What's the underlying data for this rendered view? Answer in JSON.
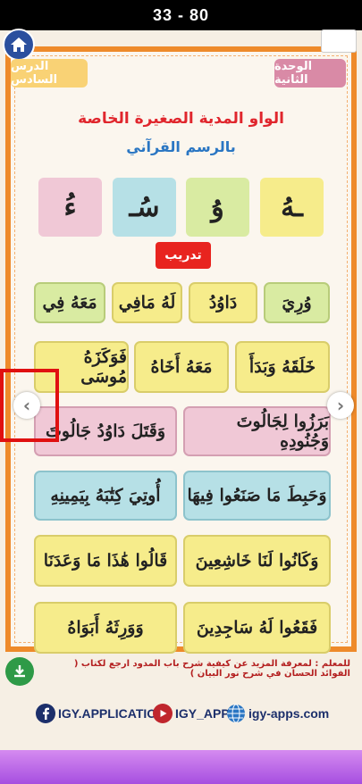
{
  "header": {
    "page_indicator": "33 - 80"
  },
  "badges": {
    "unit": "الوحدة الثانية",
    "lesson": "الدرس السادس"
  },
  "titles": {
    "main": "الواو المدية الصغيرة الخاصة",
    "sub": "بالرسم القرآني"
  },
  "letters": [
    "ـهُ",
    "ۇ",
    "سُـ",
    "ءُ"
  ],
  "drill_label": "تدريب",
  "rows": [
    [
      "وُرِيَ",
      "دَاوُدُ",
      "لَهُ مَافِي",
      "مَعَهُ فِي"
    ],
    [
      "خَلَقَهُ وَبَدَأَ",
      "مَعَهُ أَخَاهُ",
      "فَوَكَزَهُ مُوسَى"
    ],
    [
      "بَرَزُوا لِجَالُوتَ وَجُنُودِهِ",
      "وَقَتَلَ دَاوُدُ جَالُوتَ"
    ],
    [
      "وَحَبِطَ مَا صَنَعُوا فِيهَا",
      "أُوتِيَ كِتَٰبَهُ بِيَمِينِهِ"
    ],
    [
      "وَكَانُوا لَنَا خَاشِعِينَ",
      "قَالُوا هَٰذَا مَا وَعَدَنَا"
    ],
    [
      "فَقَعُوا لَهُ سَاجِدِينَ",
      "وَوَرِثَهُ أَبَوَاهُ"
    ]
  ],
  "note": "للمعلم : لمعرفة المزيد عن كيفية شرح باب المدود ارجع لكتاب ( الفوائد الحسان في شرح نور البيان )",
  "social": {
    "facebook": "IGY.APPLICATION",
    "youtube": "IGY_APP",
    "website": "igy-apps.com"
  },
  "icons": {
    "home": "home-icon",
    "download": "download-icon",
    "prev": "chevron-left-icon",
    "next": "chevron-right-icon"
  }
}
